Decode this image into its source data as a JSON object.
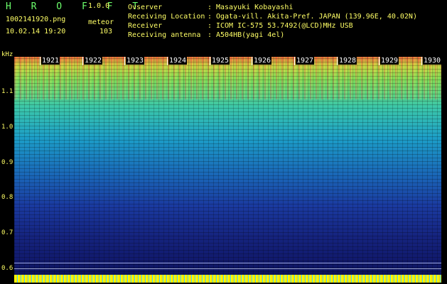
{
  "header": {
    "app_title": "H R O F F T",
    "app_version": "1.0.0",
    "file_name": "1002141920.png",
    "mode": "meteor",
    "datetime": "10.02.14 19:20",
    "count": "103"
  },
  "info": [
    {
      "key": "Ovserver",
      "value": "Masayuki Kobayashi"
    },
    {
      "key": "Receiving Location",
      "value": "Ogata-vill. Akita-Pref. JAPAN (139.96E, 40.02N)"
    },
    {
      "key": "Receiver",
      "value": "ICOM IC-575 53.7492(@LCD)MHz USB"
    },
    {
      "key": "Receiving antenna",
      "value": "A504HB(yagi 4el)"
    }
  ],
  "axis": {
    "unit": "kHz",
    "y_ticks": [
      "1.1",
      "1.0",
      "0.9",
      "0.8",
      "0.7",
      "0.6"
    ],
    "time_marks": [
      "1921",
      "1922",
      "1923",
      "1924",
      "1925",
      "1926",
      "1927",
      "1928",
      "1929",
      "1930"
    ]
  }
}
